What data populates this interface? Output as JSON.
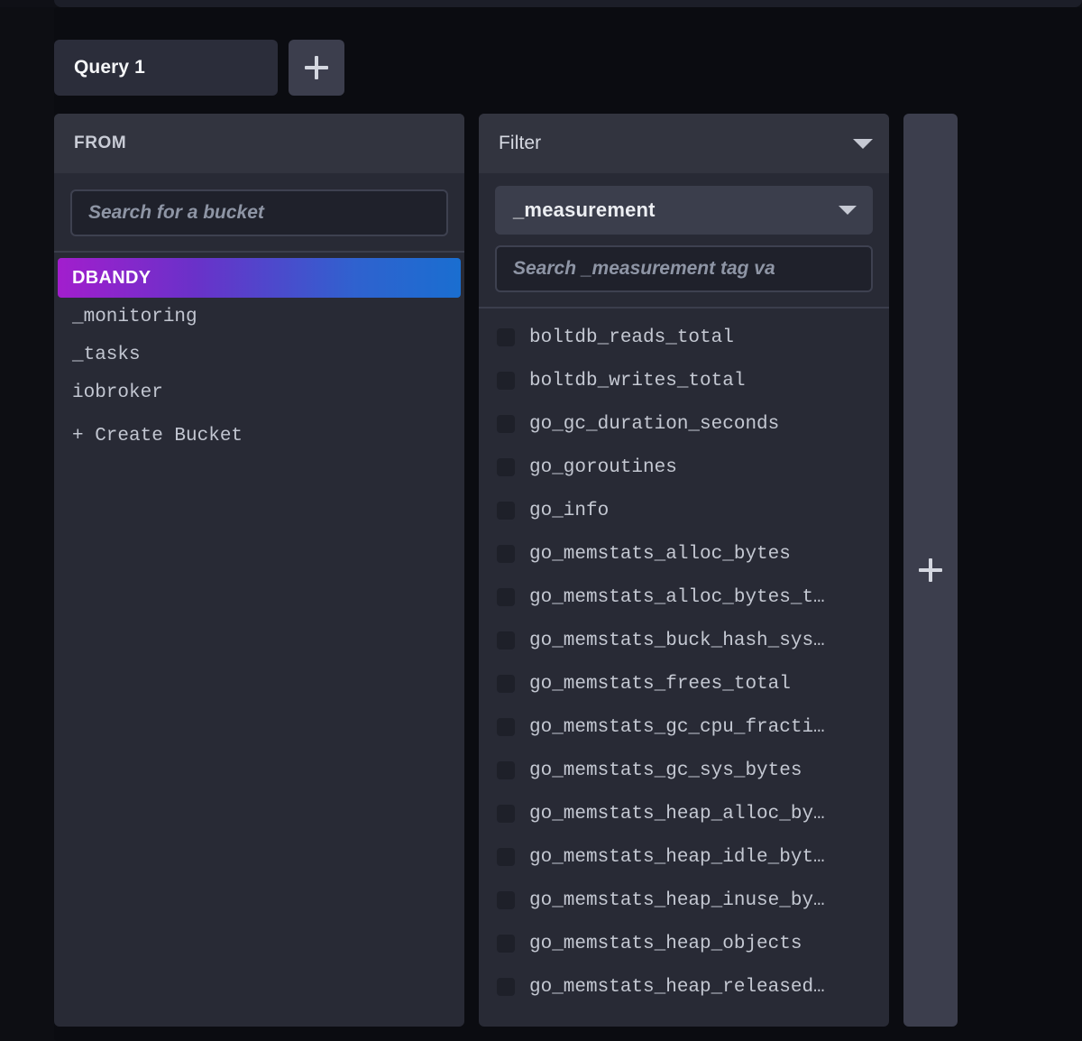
{
  "query_tabs": {
    "active_tab_label": "Query 1",
    "add_query_icon": "plus-icon"
  },
  "from_card": {
    "header_title": "FROM",
    "search_placeholder": "Search for a bucket",
    "buckets": [
      {
        "label": "DBANDY",
        "selected": true
      },
      {
        "label": "_monitoring",
        "selected": false
      },
      {
        "label": "_tasks",
        "selected": false
      },
      {
        "label": "iobroker",
        "selected": false
      }
    ],
    "create_bucket_label": "+ Create Bucket"
  },
  "filter_card": {
    "header_title": "Filter",
    "header_caret_icon": "chevron-down-icon",
    "selected_tag_key": "_measurement",
    "tag_key_caret_icon": "chevron-down-icon",
    "tag_value_search_placeholder": "Search _measurement tag va",
    "measurements": [
      {
        "label": "boltdb_reads_total",
        "checked": false
      },
      {
        "label": "boltdb_writes_total",
        "checked": false
      },
      {
        "label": "go_gc_duration_seconds",
        "checked": false
      },
      {
        "label": "go_goroutines",
        "checked": false
      },
      {
        "label": "go_info",
        "checked": false
      },
      {
        "label": "go_memstats_alloc_bytes",
        "checked": false
      },
      {
        "label": "go_memstats_alloc_bytes_t…",
        "checked": false
      },
      {
        "label": "go_memstats_buck_hash_sys…",
        "checked": false
      },
      {
        "label": "go_memstats_frees_total",
        "checked": false
      },
      {
        "label": "go_memstats_gc_cpu_fracti…",
        "checked": false
      },
      {
        "label": "go_memstats_gc_sys_bytes",
        "checked": false
      },
      {
        "label": "go_memstats_heap_alloc_by…",
        "checked": false
      },
      {
        "label": "go_memstats_heap_idle_byt…",
        "checked": false
      },
      {
        "label": "go_memstats_heap_inuse_by…",
        "checked": false
      },
      {
        "label": "go_memstats_heap_objects",
        "checked": false
      },
      {
        "label": "go_memstats_heap_released…",
        "checked": false
      }
    ]
  },
  "add_card": {
    "icon": "plus-icon"
  },
  "colors": {
    "page_background": "#0f1016",
    "card_background": "#282a35",
    "card_header_background": "#32343f",
    "accent_gradient_start": "#a21ecd",
    "accent_gradient_end": "#1a6ed0",
    "text_primary": "#e6e8ee",
    "text_secondary": "#c4c8d2",
    "placeholder": "#8e95a5"
  }
}
